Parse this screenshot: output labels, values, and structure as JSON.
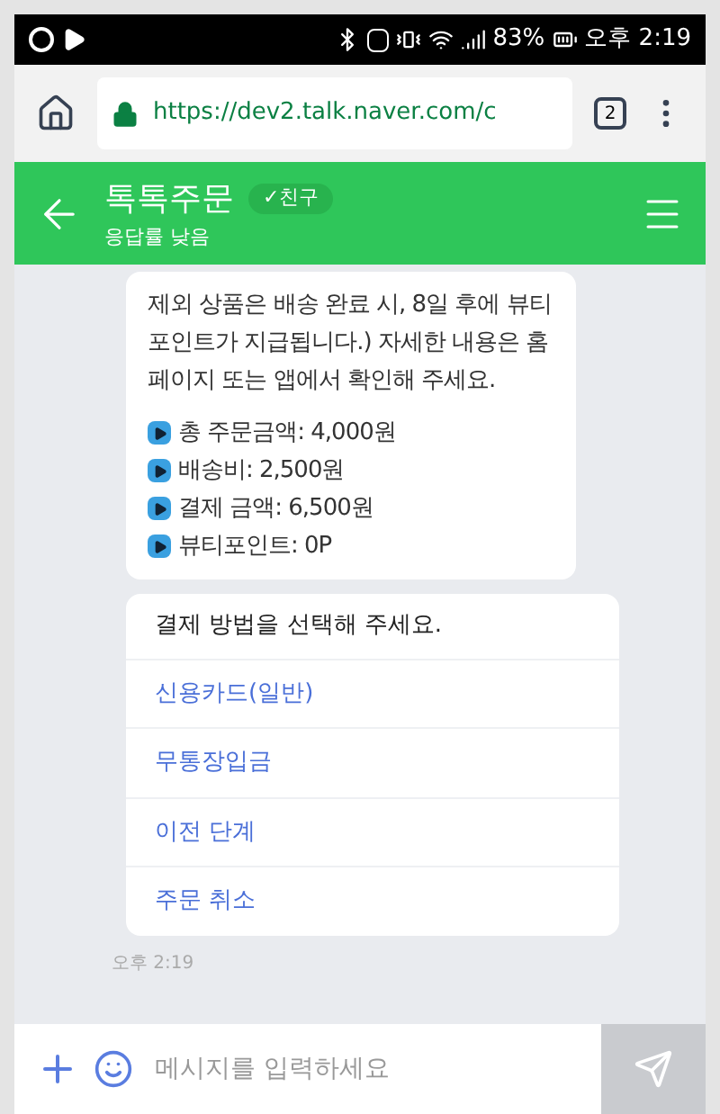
{
  "status_bar": {
    "battery": "83%",
    "time": "오후 2:19"
  },
  "browser": {
    "url": "https://dev2.talk.naver.com/c",
    "tab_count": "2"
  },
  "header": {
    "title": "톡톡주문",
    "badge": "✓친구",
    "subtitle": "응답률 낮음"
  },
  "message": {
    "text": "제외 상품은 배송 완료 시, 8일 후에 뷰티 포인트가 지급됩니다.) 자세한 내용은 홈페이지 또는 앱에서 확인해 주세요.",
    "summary": [
      "총 주문금액: 4,000원",
      "배송비: 2,500원",
      "결제 금액: 6,500원",
      "뷰티포인트: 0P"
    ]
  },
  "card": {
    "prompt": "결제 방법을 선택해 주세요.",
    "options": [
      "신용카드(일반)",
      "무통장입금",
      "이전 단계",
      "주문 취소"
    ]
  },
  "timestamp": "오후 2:19",
  "input": {
    "placeholder": "메시지를 입력하세요"
  }
}
